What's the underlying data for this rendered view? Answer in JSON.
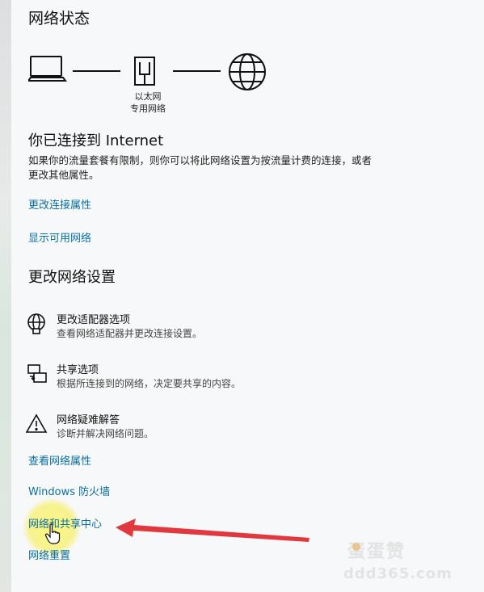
{
  "page": {
    "title": "网络状态"
  },
  "diagram": {
    "adapter_caption": "以太网\n专用网络"
  },
  "status": {
    "title": "你已连接到 Internet",
    "description": "如果你的流量套餐有限制，则你可以将此网络设置为按流量计费的连接，或者更改其他属性。"
  },
  "links": {
    "change_connection_properties": "更改连接属性",
    "show_available_networks": "显示可用网络",
    "view_network_properties": "查看网络属性",
    "windows_firewall": "Windows 防火墙",
    "network_sharing_center": "网络和共享中心",
    "network_reset": "网络重置"
  },
  "settings": {
    "section_title": "更改网络设置",
    "items": [
      {
        "icon": "globe-adapter-icon",
        "title": "更改适配器选项",
        "description": "查看网络适配器并更改连接设置。"
      },
      {
        "icon": "sharing-icon",
        "title": "共享选项",
        "description": "根据所连接到的网络，决定要共享的内容。"
      },
      {
        "icon": "warning-icon",
        "title": "网络疑难解答",
        "description": "诊断并解决网络问题。"
      }
    ]
  },
  "colors": {
    "link": "#0a6f9e",
    "background": "#f7f8f9",
    "arrow": "#e0383e",
    "highlight": "#f7f06e"
  },
  "watermark": {
    "main": "蛋蛋赞",
    "sub": "ddd365.com"
  }
}
